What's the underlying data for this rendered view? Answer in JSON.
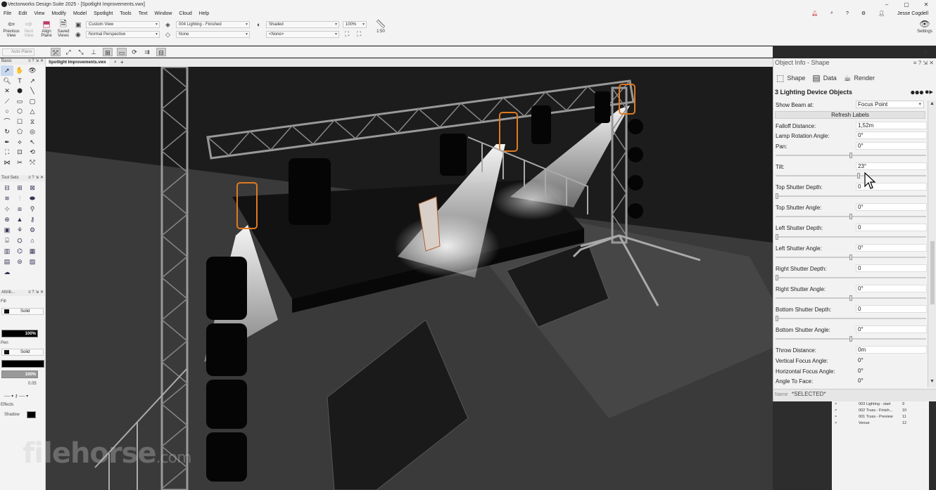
{
  "window": {
    "title": "Vectorworks Design Suite 2025 - [Spotlight Improvements.vwx]",
    "controls": [
      "–",
      "▢",
      "✕"
    ]
  },
  "menu": {
    "items": [
      "File",
      "Edit",
      "View",
      "Modify",
      "Model",
      "Spotlight",
      "Tools",
      "Text",
      "Window",
      "Cloud",
      "Help"
    ],
    "user": "Jesse Cogdell"
  },
  "toolbar": {
    "previous_view": "Previous View",
    "next_view": "Next View",
    "align_plane": "Align Plane",
    "saved_views": "Saved Views",
    "view_dropdown": "Custom View",
    "projection_dropdown": "Normal Perspective",
    "layer_dropdown": "004 Lighting - Finished",
    "class_dropdown": "None",
    "render_dropdown": "Shaded",
    "render_secondary": "<None>",
    "zoom": "100%",
    "scale": "1:50",
    "settings": "Settings"
  },
  "modebar": {
    "auto_plane": "Auto-Plane"
  },
  "document_tab": {
    "name": "Spotlight Improvements.vwx",
    "close": "×",
    "add": "+"
  },
  "palettes": {
    "basic_title": "Basic",
    "toolsets_title": "Tool Sets",
    "attributes_title": "Attrib...",
    "fill_label": "Fill",
    "fill_style": "Solid",
    "fill_opacity": "100%",
    "pen_label": "Pen",
    "pen_style": "Solid",
    "pen_opacity": "100%",
    "line_weight": "0.05",
    "effects_label": "Effects",
    "shadow_label": "Shadow"
  },
  "object_info": {
    "title": "Object Info - Shape",
    "tabs": {
      "shape": "Shape",
      "data": "Data",
      "render": "Render"
    },
    "object_count": "3 Lighting Device Objects",
    "show_beam_label": "Show Beam at:",
    "show_beam_value": "Focus Point",
    "refresh_labels": "Refresh Labels",
    "fields": [
      {
        "label": "Falloff Distance:",
        "value": "1,52m"
      },
      {
        "label": "Lamp Rotation Angle:",
        "value": "0°"
      },
      {
        "label": "Pan:",
        "value": "0°"
      },
      {
        "label": "Tilt:",
        "value": "23°"
      },
      {
        "label": "Top Shutter Depth:",
        "value": "0"
      },
      {
        "label": "Top Shutter Angle:",
        "value": "0°"
      },
      {
        "label": "Left Shutter Depth:",
        "value": "0"
      },
      {
        "label": "Left Shutter Angle:",
        "value": "0°"
      },
      {
        "label": "Right Shutter Depth:",
        "value": "0"
      },
      {
        "label": "Right Shutter Angle:",
        "value": "0°"
      },
      {
        "label": "Bottom Shutter Depth:",
        "value": "0"
      },
      {
        "label": "Bottom Shutter Angle:",
        "value": "0°"
      },
      {
        "label": "Throw Distance:",
        "value": "0m"
      },
      {
        "label": "Vertical Focus Angle:",
        "value": "0°"
      },
      {
        "label": "Horizontal Focus Angle:",
        "value": "0°"
      },
      {
        "label": "Angle To Face:",
        "value": "0°"
      }
    ],
    "slider_levels": {
      "pan": 0.5,
      "tilt": 0.55,
      "top_shutter_depth": 0.0,
      "top_shutter_angle": 0.5,
      "left_shutter_depth": 0.0,
      "left_shutter_angle": 0.5,
      "right_shutter_depth": 0.0,
      "right_shutter_angle": 0.5,
      "bottom_shutter_depth": 0.0,
      "bottom_shutter_angle": 0.5
    },
    "name_label": "Name",
    "name_value": "*SELECTED*"
  },
  "navigation": {
    "rows": [
      {
        "x": "×",
        "name": "003 Lighting - start",
        "num": "9"
      },
      {
        "x": "×",
        "name": "002 Truss - Finish...",
        "num": "10"
      },
      {
        "x": "×",
        "name": "001 Truss - Preview",
        "num": "11"
      },
      {
        "x": "×",
        "name": "Venue",
        "num": "12"
      }
    ]
  },
  "watermark": {
    "brand": "filehorse",
    "suffix": ".com"
  },
  "colors": {
    "accent": "#4a7fc1",
    "fixture_selected": "#e07a20",
    "beam": "#ffffff",
    "stage": "#151515"
  }
}
